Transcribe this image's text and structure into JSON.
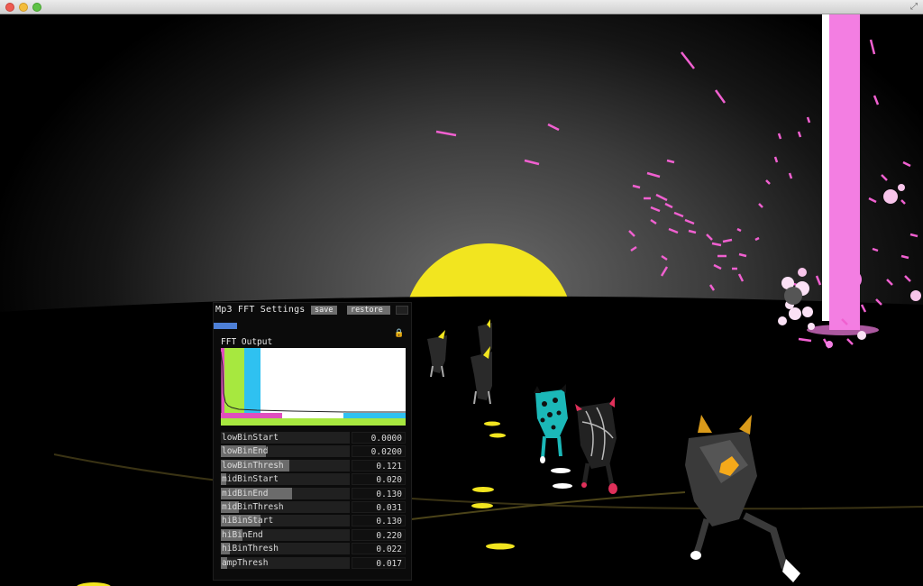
{
  "window": {
    "fullscreen_icon": "⤢"
  },
  "panel": {
    "title": "Mp3 FFT Settings",
    "save_label": "save",
    "restore_label": "restore",
    "lock_icon": "🔒",
    "fft_label": "FFT Output",
    "band_colors": {
      "low": "#e04fbd",
      "mid": "#a7e83f",
      "hi": "#2fc1f0"
    },
    "sliders": [
      {
        "label": "lowBinStart",
        "value": "0.0000",
        "fill": 0.0
      },
      {
        "label": "lowBinEnd",
        "value": "0.0200",
        "fill": 0.35
      },
      {
        "label": "lowBinThresh",
        "value": "0.121",
        "fill": 0.53
      },
      {
        "label": "midBinStart",
        "value": "0.020",
        "fill": 0.04
      },
      {
        "label": "midBinEnd",
        "value": "0.130",
        "fill": 0.55
      },
      {
        "label": "midBinThresh",
        "value": "0.031",
        "fill": 0.14
      },
      {
        "label": "hiBinStart",
        "value": "0.130",
        "fill": 0.31
      },
      {
        "label": "hiBinEnd",
        "value": "0.220",
        "fill": 0.17
      },
      {
        "label": "hiBinThresh",
        "value": "0.022",
        "fill": 0.07
      },
      {
        "label": "ampThresh",
        "value": "0.017",
        "fill": 0.05
      }
    ]
  },
  "scene": {
    "sun_color": "#f2e51f",
    "beam_color": "#f37ee2",
    "particle_color": "#f060d0",
    "marker_color": "#f2e51f"
  }
}
